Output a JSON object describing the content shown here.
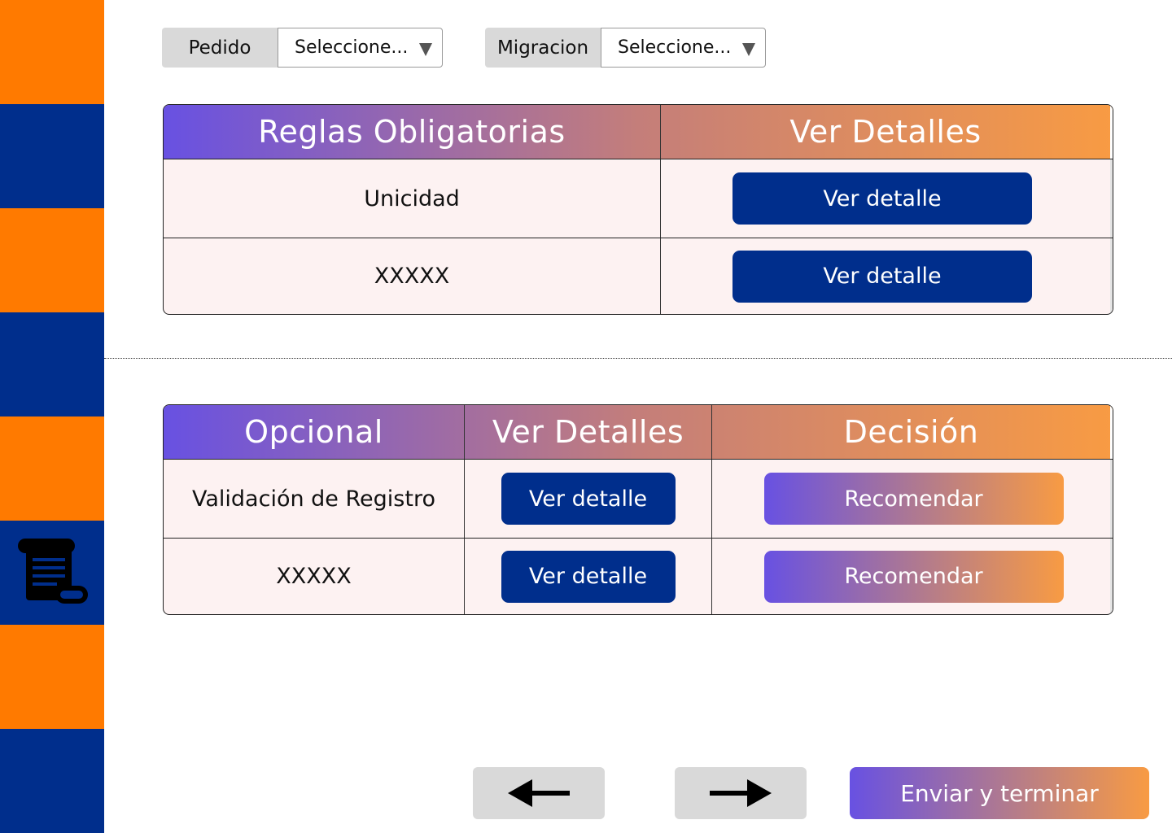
{
  "sidebar": {
    "colors": {
      "orange": "#FF7A00",
      "blue": "#002E8C"
    },
    "active_icon": "scroll-icon"
  },
  "filters": [
    {
      "label": "Pedido",
      "value": "Seleccione..."
    },
    {
      "label": "Migracion",
      "value": "Seleccione..."
    }
  ],
  "mandatory_table": {
    "headers": [
      "Reglas Obligatorias",
      "Ver Detalles"
    ],
    "rows": [
      {
        "rule": "Unicidad",
        "action": "Ver detalle"
      },
      {
        "rule": "XXXXX",
        "action": "Ver detalle"
      }
    ]
  },
  "optional_table": {
    "headers": [
      "Opcional",
      "Ver Detalles",
      "Decisión"
    ],
    "rows": [
      {
        "rule": "Validación de Registro",
        "action": "Ver detalle",
        "decision": "Recomendar"
      },
      {
        "rule": "XXXXX",
        "action": "Ver detalle",
        "decision": "Recomendar"
      }
    ]
  },
  "navigation": {
    "back_icon": "arrow-left-icon",
    "next_icon": "arrow-right-icon",
    "submit_label": "Enviar y terminar"
  },
  "colors": {
    "primary_blue": "#002E8C",
    "gradient_start": "#6851E2",
    "gradient_end": "#F89B43",
    "row_background": "#FDF2F2"
  }
}
